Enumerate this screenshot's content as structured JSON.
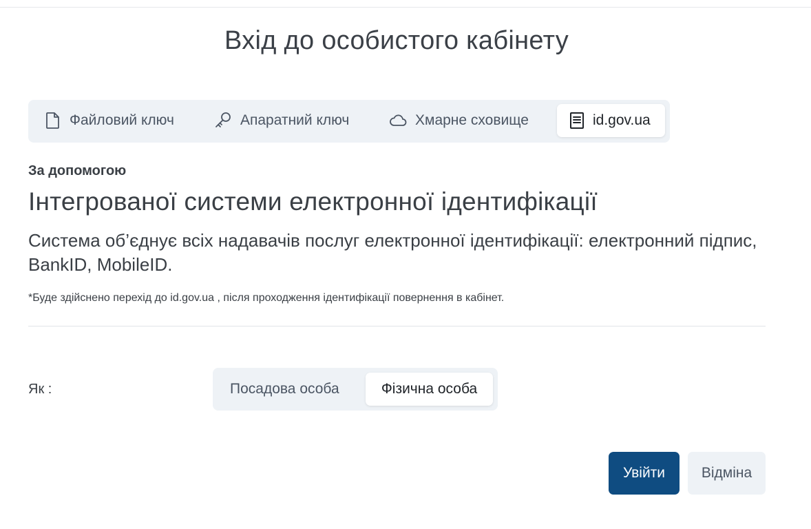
{
  "page": {
    "title": "Вхід до особистого кабінету"
  },
  "tabs": [
    {
      "label": "Файловий ключ",
      "icon": "file-icon",
      "active": false
    },
    {
      "label": "Апаратний ключ",
      "icon": "key-icon",
      "active": false
    },
    {
      "label": "Хмарне сховище",
      "icon": "cloud-icon",
      "active": false
    },
    {
      "label": "id.gov.ua",
      "icon": "document-icon",
      "active": true
    }
  ],
  "content": {
    "subheading": "За допомогою",
    "heading": "Інтегрованої системи електронної ідентифікації",
    "description": "Система об’єднує всіх надавачів послуг електронної ідентифікації: електронний підпис, BankID, MobileID.",
    "note": "*Буде здійснено перехід до id.gov.ua , після проходження ідентифікації повернення в кабінет."
  },
  "role": {
    "label": "Як :",
    "options": [
      {
        "label": "Посадова особа",
        "selected": false
      },
      {
        "label": "Фізична особа",
        "selected": true
      }
    ]
  },
  "actions": {
    "login_label": "Увійти",
    "cancel_label": "Відміна"
  },
  "colors": {
    "primary": "#0f4c81",
    "tab_bg": "#eef2f6",
    "text": "#3a3f45"
  }
}
